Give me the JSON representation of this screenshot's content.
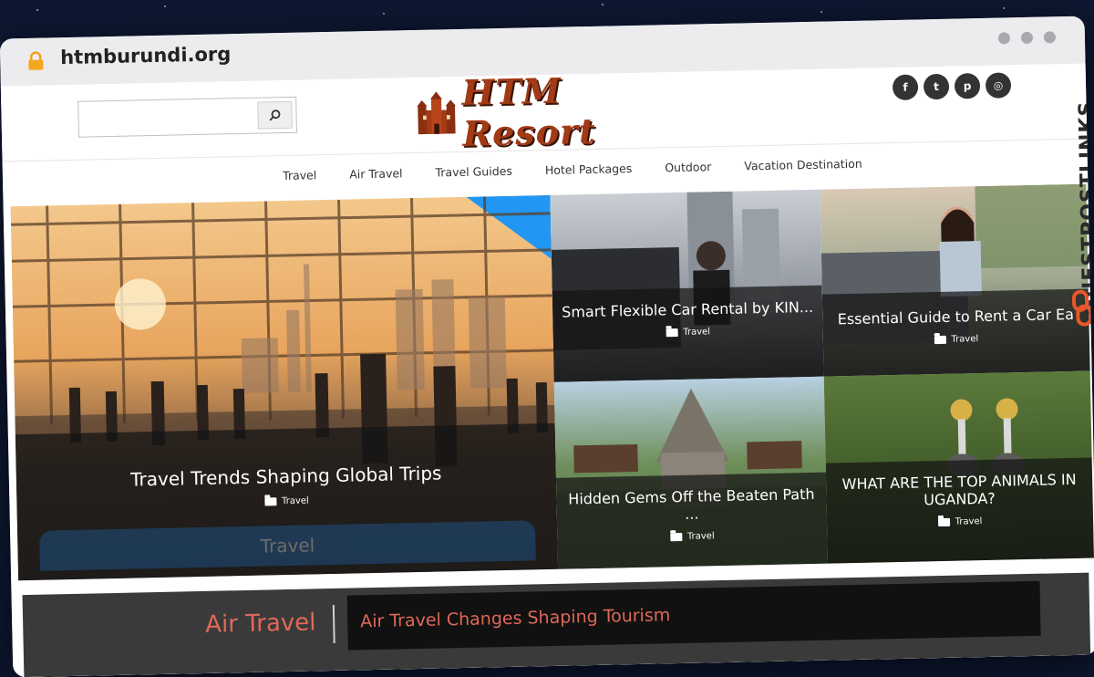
{
  "browser": {
    "url": "htmburundi.org"
  },
  "header": {
    "search_placeholder": "",
    "logo_text": "HTM Resort",
    "socials": [
      {
        "icon": "facebook-icon",
        "glyph": "f"
      },
      {
        "icon": "twitter-icon",
        "glyph": "t"
      },
      {
        "icon": "pinterest-icon",
        "glyph": "p"
      },
      {
        "icon": "instagram-icon",
        "glyph": "◎"
      }
    ]
  },
  "nav": {
    "items": [
      "Travel",
      "Air Travel",
      "Travel Guides",
      "Hotel Packages",
      "Outdoor",
      "Vacation Destination"
    ]
  },
  "featured": {
    "main": {
      "title": "Travel Trends Shaping Global Trips",
      "category": "Travel",
      "tag": "Travel"
    },
    "top_middle": {
      "title": "Smart Flexible Car Rental by KIN...",
      "category": "Travel"
    },
    "top_right": {
      "title": "Essential Guide to Rent a Car Ea",
      "category": "Travel"
    },
    "bottom_middle": {
      "title": "Hidden Gems Off the Beaten Path ...",
      "category": "Travel"
    },
    "bottom_right": {
      "title": "WHAT ARE THE TOP ANIMALS IN UGANDA?",
      "category": "Travel"
    }
  },
  "trending": {
    "label": "Air Travel",
    "headline": "Air Travel Changes Shaping Tourism"
  },
  "watermark": {
    "text": "GUESTPOSTLINKS"
  },
  "colors": {
    "accent": "#e06858",
    "logo": "#a23a16",
    "background": "#0d1730"
  }
}
